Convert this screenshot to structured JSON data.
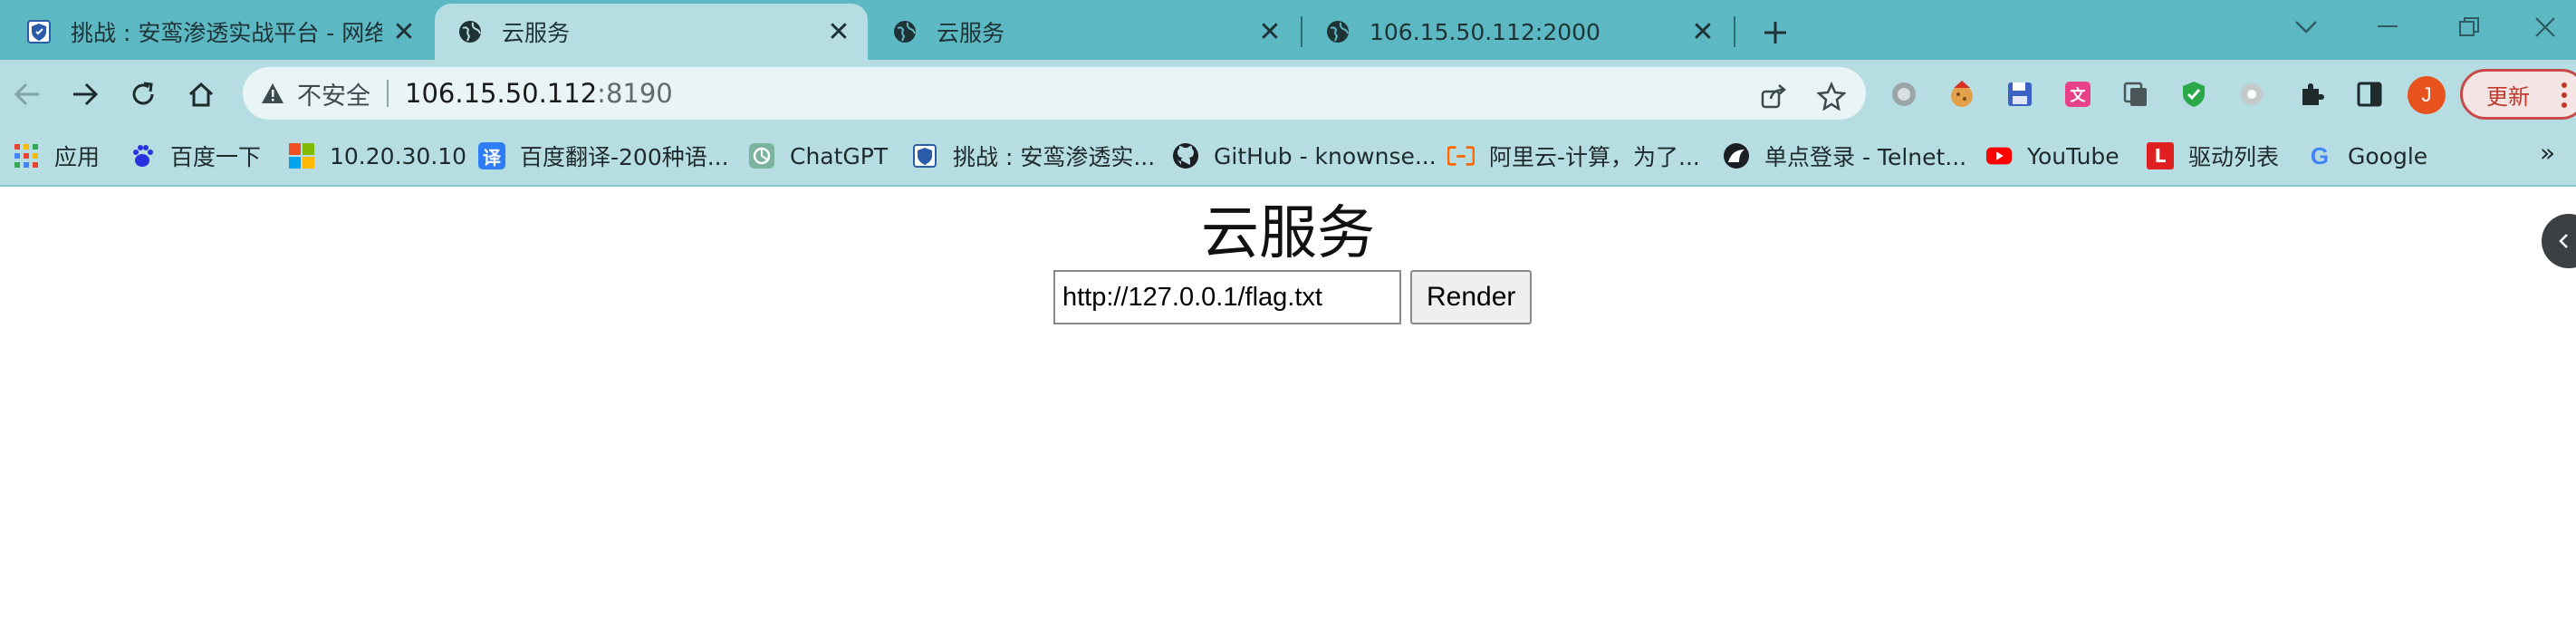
{
  "tabs": [
    {
      "title": "挑战 : 安鸾渗透实战平台 - 网络安",
      "icon": "shield-favicon-icon",
      "active": false
    },
    {
      "title": "云服务",
      "icon": "globe-icon",
      "active": true
    },
    {
      "title": "云服务",
      "icon": "globe-icon",
      "active": false
    },
    {
      "title": "106.15.50.112:2000",
      "icon": "globe-icon",
      "active": false
    }
  ],
  "omnibox": {
    "security_label": "不安全",
    "host": "106.15.50.112",
    "port": ":8190"
  },
  "profile": {
    "initial": "J"
  },
  "update_button": {
    "label": "更新"
  },
  "bookmarks": [
    {
      "label": "应用",
      "icon": "apps-grid-icon"
    },
    {
      "label": "百度一下",
      "icon": "baidu-paw-icon"
    },
    {
      "label": "10.20.30.10",
      "icon": "windows-logo-icon"
    },
    {
      "label": "百度翻译-200种语...",
      "icon": "translate-icon",
      "glyph": "译"
    },
    {
      "label": "ChatGPT",
      "icon": "chatgpt-icon"
    },
    {
      "label": "挑战 : 安鸾渗透实...",
      "icon": "shield-favicon-icon"
    },
    {
      "label": "GitHub - knownse...",
      "icon": "github-icon"
    },
    {
      "label": "阿里云-计算，为了...",
      "icon": "aliyun-icon"
    },
    {
      "label": "单点登录 - Telnet...",
      "icon": "telnet-icon"
    },
    {
      "label": "YouTube",
      "icon": "youtube-icon"
    },
    {
      "label": "驱动列表",
      "icon": "driver-list-icon",
      "glyph": "L"
    },
    {
      "label": "Google",
      "icon": "google-icon",
      "glyph": "G"
    }
  ],
  "page": {
    "heading": "云服务",
    "url_value": "http://127.0.0.1/flag.txt",
    "render_label": "Render"
  },
  "colors": {
    "tab_strip": "#5cb8c3",
    "toolbar": "#b6dde2",
    "accent_update": "#c0392b"
  }
}
